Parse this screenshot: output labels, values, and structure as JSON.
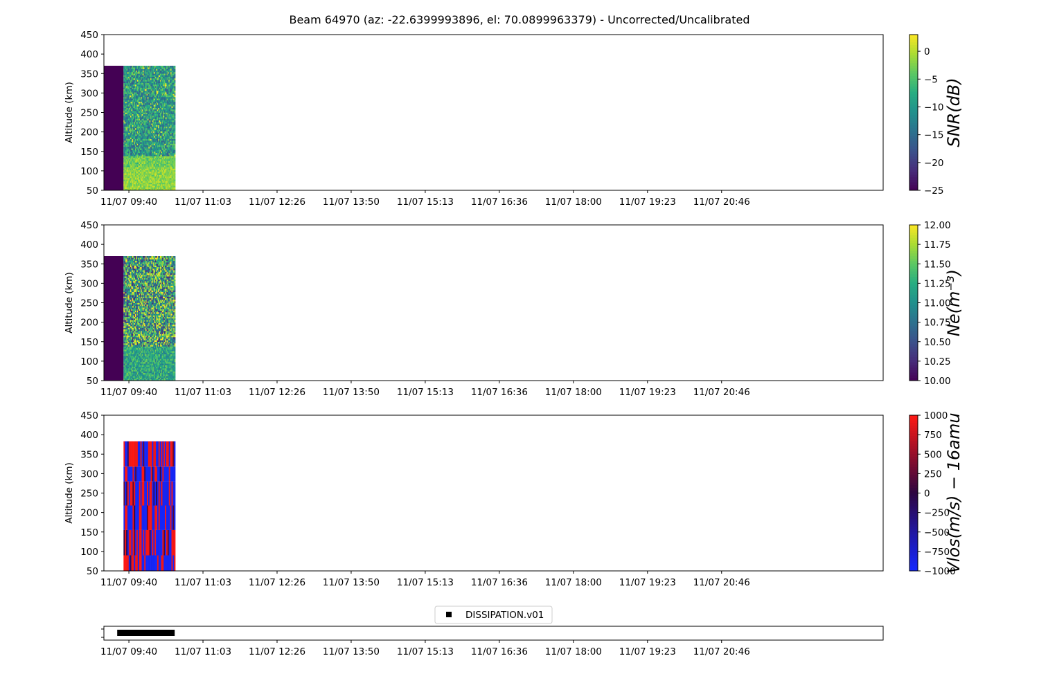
{
  "chart_data": {
    "title": "Beam 64970 (az: -22.6399993896, el: 70.0899963379) - Uncorrected/Uncalibrated",
    "x_tick_labels": [
      "11/07 09:40",
      "11/07 11:03",
      "11/07 12:26",
      "11/07 13:50",
      "11/07 15:13",
      "11/07 16:36",
      "11/07 18:00",
      "11/07 19:23",
      "11/07 20:46"
    ],
    "x_range_min": [
      -28,
      845
    ],
    "panels": [
      {
        "type": "heatmap",
        "ylabel": "Altitude (km)",
        "yticks": [
          50,
          100,
          150,
          200,
          250,
          300,
          350,
          400,
          450
        ],
        "ylim": [
          50,
          450
        ],
        "colormap": "viridis",
        "colorbar_label": "SNR(dB)",
        "colorbar_ticks": [
          "0",
          "−5",
          "−10",
          "−15",
          "−20",
          "−25"
        ],
        "colorbar_tick_values": [
          0,
          -5,
          -10,
          -15,
          -20,
          -25
        ],
        "clim": [
          -25,
          3
        ],
        "data_time_range_min": [
          -28,
          52
        ],
        "data_alt_range_km": [
          50,
          370
        ],
        "fill_region_min": [
          -28,
          -6
        ],
        "fill_value": -25,
        "high_band_km": [
          50,
          140
        ]
      },
      {
        "type": "heatmap",
        "ylabel": "Altitude (km)",
        "yticks": [
          50,
          100,
          150,
          200,
          250,
          300,
          350,
          400,
          450
        ],
        "ylim": [
          50,
          450
        ],
        "colormap": "viridis",
        "colorbar_label": "Ne(m⁻³)",
        "colorbar_ticks": [
          "12.00",
          "11.75",
          "11.50",
          "11.25",
          "11.00",
          "10.75",
          "10.50",
          "10.25",
          "10.00"
        ],
        "colorbar_tick_values": [
          12,
          11.75,
          11.5,
          11.25,
          11,
          10.75,
          10.5,
          10.25,
          10
        ],
        "clim": [
          10,
          12
        ],
        "data_time_range_min": [
          -28,
          52
        ],
        "data_alt_range_km": [
          50,
          370
        ],
        "fill_region_min": [
          -28,
          -6
        ],
        "fill_value": 10
      },
      {
        "type": "heatmap",
        "ylabel": "Altitude (km)",
        "yticks": [
          50,
          100,
          150,
          200,
          250,
          300,
          350,
          400,
          450
        ],
        "ylim": [
          50,
          450
        ],
        "colormap": "blue-red",
        "colorbar_label": "Vlos(m/s) − 16amu",
        "colorbar_ticks": [
          "1000",
          "750",
          "500",
          "250",
          "0",
          "−250",
          "−500",
          "−750",
          "−1000"
        ],
        "colorbar_tick_values": [
          1000,
          750,
          500,
          250,
          0,
          -250,
          -500,
          -750,
          -1000
        ],
        "clim": [
          -1000,
          1000
        ],
        "data_time_range_min": [
          -6,
          52
        ],
        "data_alt_range_km": [
          50,
          383
        ],
        "alt_bands_km": [
          [
            50,
            90
          ],
          [
            90,
            155
          ],
          [
            155,
            218
          ],
          [
            218,
            280
          ],
          [
            280,
            318
          ],
          [
            318,
            383
          ]
        ]
      }
    ],
    "legend_panel": {
      "type": "scatter",
      "series": [
        {
          "name": "DISSIPATION.v01",
          "x_range_min": [
            -10,
            50
          ],
          "marker": "square",
          "color": "#000000"
        }
      ],
      "legend_position": "upper center"
    }
  }
}
